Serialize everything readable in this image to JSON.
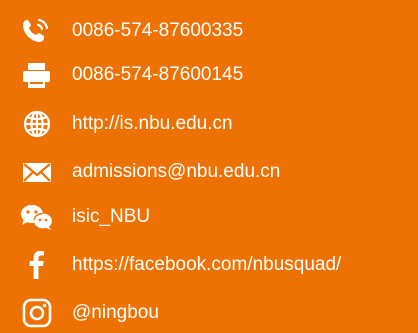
{
  "colors": {
    "background": "#ee7203",
    "text": "#ffffff"
  },
  "contacts": [
    {
      "icon": "phone-icon",
      "text": "0086-574-87600335"
    },
    {
      "icon": "fax-icon",
      "text": "0086-574-87600145"
    },
    {
      "icon": "globe-icon",
      "text": "http://is.nbu.edu.cn"
    },
    {
      "icon": "email-icon",
      "text": "admissions@nbu.edu.cn"
    },
    {
      "icon": "wechat-icon",
      "text": "isic_NBU"
    },
    {
      "icon": "facebook-icon",
      "text": "https://facebook.com/nbusquad/"
    },
    {
      "icon": "instagram-icon",
      "text": "@ningbou"
    }
  ]
}
